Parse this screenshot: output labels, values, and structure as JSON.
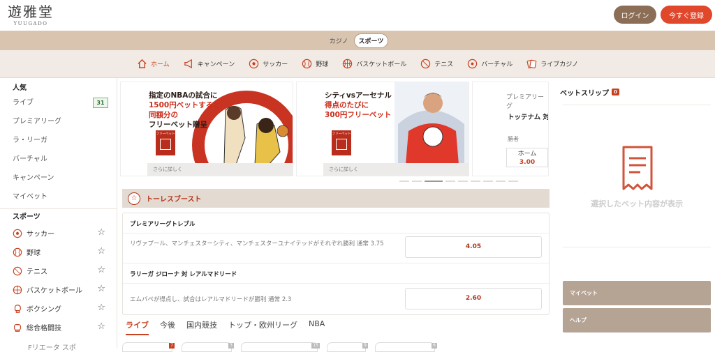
{
  "header": {
    "logo_main": "遊雅堂",
    "logo_sub": "YUUGADO",
    "login_label": "ログイン",
    "register_label": "今すぐ登録"
  },
  "switcher": {
    "casino": "カジノ",
    "sports": "スポーツ"
  },
  "categories": [
    {
      "label": "ホーム",
      "icon": "home-icon"
    },
    {
      "label": "キャンペーン",
      "icon": "megaphone-icon"
    },
    {
      "label": "サッカー",
      "icon": "soccer-ball-icon"
    },
    {
      "label": "野球",
      "icon": "baseball-icon"
    },
    {
      "label": "バスケットボール",
      "icon": "basketball-icon"
    },
    {
      "label": "テニス",
      "icon": "tennis-ball-icon"
    },
    {
      "label": "バーチャル",
      "icon": "virtual-icon"
    },
    {
      "label": "ライブカジノ",
      "icon": "live-casino-icon"
    }
  ],
  "sidebar": {
    "popular_heading": "人気",
    "popular_items": [
      "ライブ",
      "プレミアリーグ",
      "ラ・リーガ",
      "バーチャル",
      "キャンペーン",
      "マイベット"
    ],
    "live_count": "31",
    "sports_heading": "スポーツ",
    "sports": [
      "サッカー",
      "野球",
      "テニス",
      "バスケットボール",
      "ボクシング",
      "総合格闘技"
    ],
    "cut_item": "Fリエータ スポ"
  },
  "banners": {
    "b1": {
      "line1": "指定のNBAの試合に",
      "line2": "1500円ベットすると",
      "line3": "同額分の",
      "line4": "フリーベット贈呈",
      "gift": "フリーベット",
      "more": "さらに詳しく"
    },
    "b2": {
      "line1": "シティvsアーセナル",
      "line2": "得点のたびに",
      "line3": "300円フリーベット",
      "gift": "フリーベット",
      "more": "さらに詳しく"
    },
    "b3": {
      "league": "プレミアリーグ",
      "match": "トッテナム 対",
      "winner": "勝者",
      "odd_label": "ホーム",
      "odd_value": "3.00"
    }
  },
  "boost": {
    "title": "トーレスブースト",
    "markets": [
      {
        "title": "プレミアリーグトレブル",
        "desc": "リヴァプール、マンチェスターシティ、マンチェスターユナイテッドがそれぞれ勝利 通常 3.75",
        "odd": "4.05"
      },
      {
        "title": "ラリーガ ジローナ 対 レアルマドリード",
        "desc": "エムバペが得点し、試合はレアルマドリードが勝利 通常 2.3",
        "odd": "2.60"
      }
    ]
  },
  "tabs": [
    "ライブ",
    "今後",
    "国内競技",
    "トップ・欧州リーグ",
    "NBA"
  ],
  "pills": [
    {
      "count": "7"
    },
    {
      "count": "3"
    },
    {
      "count": "15"
    },
    {
      "count": "9"
    },
    {
      "count": "6"
    }
  ],
  "betslip": {
    "title": "ベットスリップ",
    "count": "0",
    "empty_message": "選択したベット内容が表示",
    "mybet_label": "マイベット",
    "help_label": "ヘルプ"
  },
  "colors": {
    "accent": "#c8401f",
    "brown": "#8b6e55",
    "register": "#e0472b",
    "tan": "#d9c4b0"
  }
}
